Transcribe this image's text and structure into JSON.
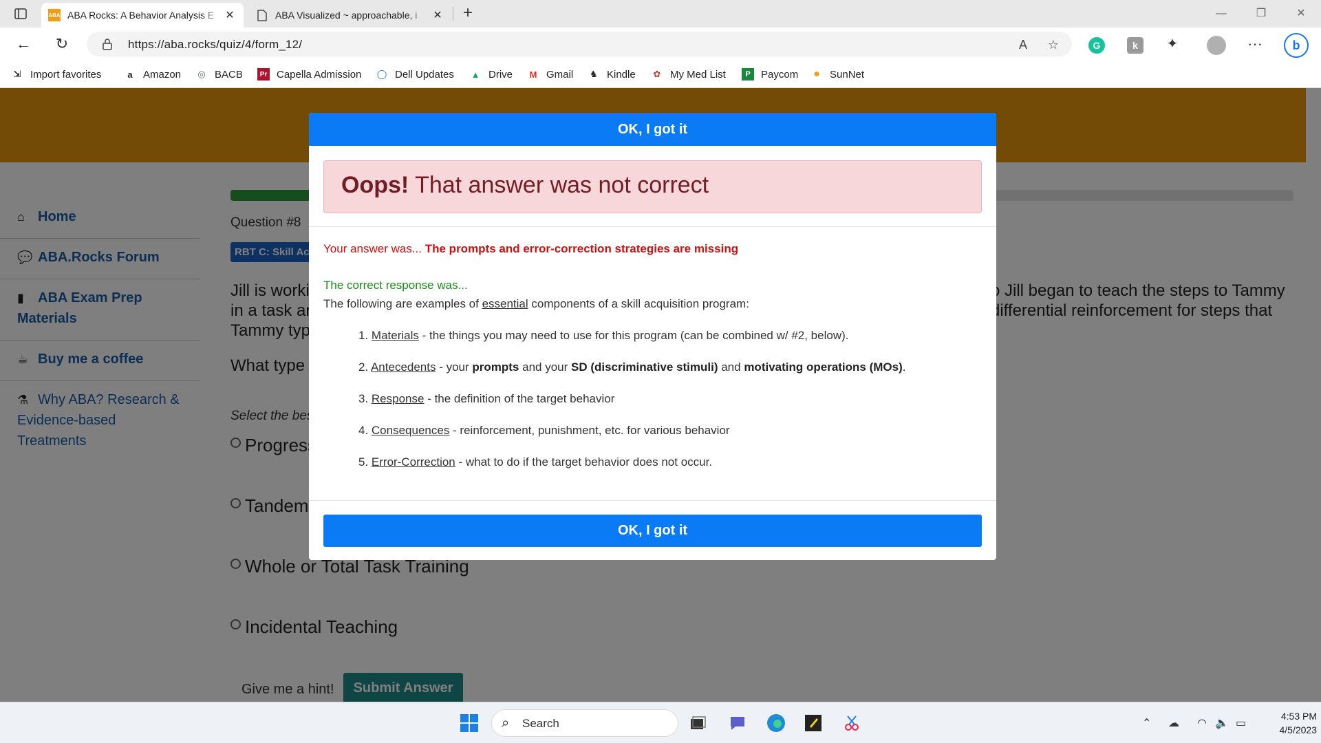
{
  "browser": {
    "tabs": [
      {
        "title": "ABA Rocks: A Behavior Analysis E",
        "favicon_text": "ABA",
        "active": true
      },
      {
        "title": "ABA Visualized ~ approachable, i",
        "active": false
      }
    ],
    "address": "https://aba.rocks/quiz/4/form_12/",
    "bookmarks": [
      {
        "label": "Import favorites",
        "icon": "import-icon"
      },
      {
        "label": "Amazon",
        "icon": "amazon-icon"
      },
      {
        "label": "BACB",
        "icon": "bacb-icon"
      },
      {
        "label": "Capella Admission",
        "icon": "capella-icon",
        "icon_text": "Pr"
      },
      {
        "label": "Dell Updates",
        "icon": "dell-icon"
      },
      {
        "label": "Drive",
        "icon": "drive-icon"
      },
      {
        "label": "Gmail",
        "icon": "gmail-icon",
        "icon_text": "M"
      },
      {
        "label": "Kindle",
        "icon": "kindle-icon"
      },
      {
        "label": "My Med List",
        "icon": "med-list-icon"
      },
      {
        "label": "Paycom",
        "icon": "paycom-icon"
      },
      {
        "label": "SunNet",
        "icon": "sunnet-icon"
      }
    ]
  },
  "sidebar": {
    "items": [
      {
        "label": "Home",
        "icon": "home-icon"
      },
      {
        "label": "ABA.Rocks Forum",
        "icon": "forum-icon"
      },
      {
        "label": "ABA Exam Prep Materials",
        "icon": "book-icon"
      },
      {
        "label": "Buy me a coffee",
        "icon": "coffee-icon"
      },
      {
        "label": "Why ABA? Research & Evidence-based Treatments",
        "icon": "flask-icon"
      }
    ]
  },
  "quiz": {
    "progress_correct": 0.6,
    "progress_incorrect": 0.08,
    "question_number": "Question #8",
    "badge": "RBT C: Skill Ac",
    "question_left": "Jill is worki",
    "question_left_2": "in a task ar",
    "question_left_3": "Tammy typ",
    "question_right": "o Jill began to teach the steps to Tammy",
    "question_right_2": "differential reinforcement for steps that",
    "question_ask": "What type",
    "select_label": "Select the bes",
    "options": [
      "Progress",
      "Tandem",
      "Whole or Total Task Training",
      "Incidental Teaching"
    ],
    "hint": "Give me a hint!",
    "submit": "Submit Answer"
  },
  "modal": {
    "top_button": "OK, I got it",
    "alert_bold": "Oops!",
    "alert_text": "That answer was not correct",
    "your_answer_prefix": "Your answer was...",
    "your_answer": "The prompts and error-correction strategies are missing",
    "correct_label": "The correct response was...",
    "following_pre": "The following are examples of ",
    "following_u": "essential",
    "following_post": " components of a skill acquisition program:",
    "steps": [
      {
        "n": "1. ",
        "term": "Materials",
        "text": " - the things you may need to use for this program (can be combined w/ #2, below)."
      },
      {
        "n": "2. ",
        "term": "Antecedents",
        "text_a": " - your ",
        "b1": "prompts",
        "text_b": " and your ",
        "b2": "SD (discriminative stimuli)",
        "text_c": " and ",
        "b3": "motivating operations (MOs)",
        "text_d": "."
      },
      {
        "n": "3. ",
        "term": "Response",
        "text": " - the definition of the target behavior"
      },
      {
        "n": "4. ",
        "term": "Consequences",
        "text": " - reinforcement, punishment, etc. for various behavior"
      },
      {
        "n": "5. ",
        "term": "Error-Correction",
        "text": " - what to do if the target behavior does not occur."
      }
    ],
    "bottom_button": "OK, I got it"
  },
  "taskbar": {
    "search_placeholder": "Search",
    "time": "4:53 PM",
    "date": "4/5/2023"
  },
  "colors": {
    "header_orange": "#e8940e",
    "primary_blue": "#0a7bf5",
    "alert_bg": "#f8d7da",
    "error_red": "#d01010",
    "correct_green": "#1a8c1a",
    "progress_green": "#2a9a3d",
    "progress_red": "#c82333"
  }
}
